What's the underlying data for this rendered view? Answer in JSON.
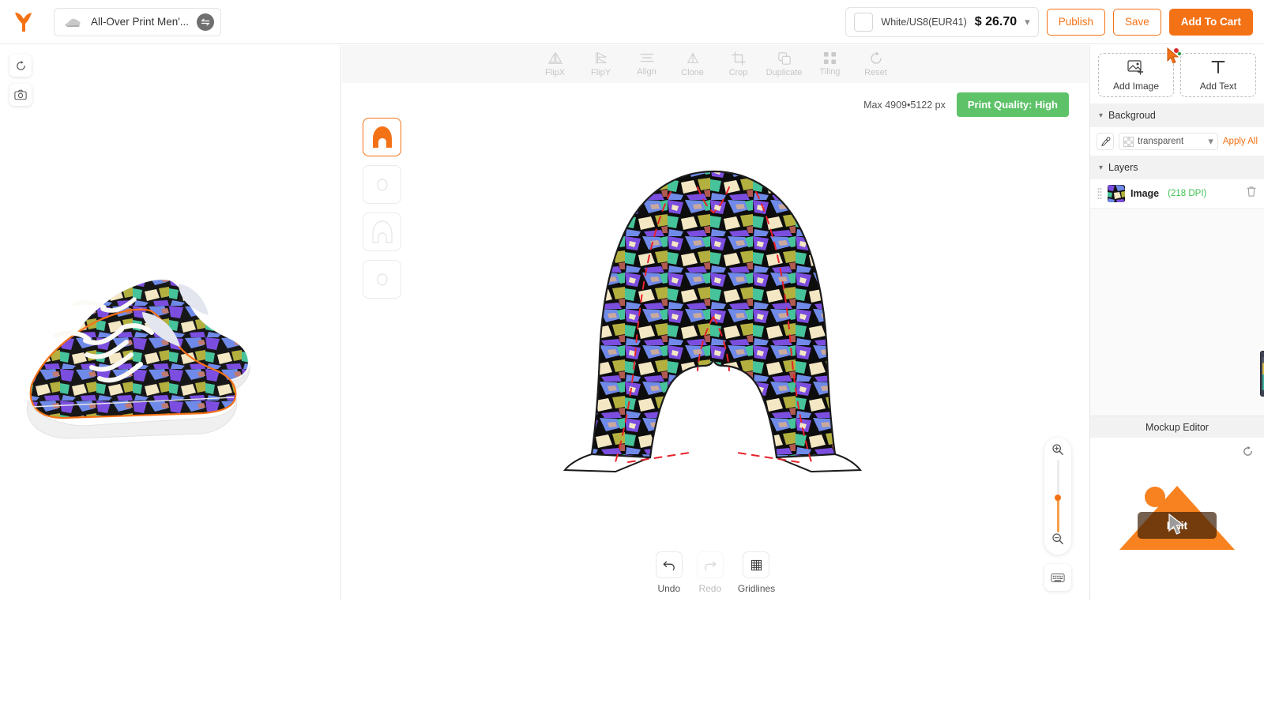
{
  "app": {
    "logo_icon": "printify-bird-logo",
    "background": "#ffffff",
    "accent": "#f47216"
  },
  "topbar": {
    "product_thumb_icon": "shoe-thumbnail-icon",
    "product_title": "All-Over Print Men'...",
    "swap_icon": "swap-product-icon",
    "variant": {
      "swatch_label": "white-color-swatch",
      "name": "White/US8(EUR41)",
      "price": "$ 26.70",
      "chevron_icon": "chevron-down-icon"
    },
    "publish_label": "Publish",
    "save_label": "Save",
    "add_to_cart_label": "Add To Cart"
  },
  "left_pane": {
    "rotate_icon": "rotate-preview-icon",
    "camera_icon": "camera-snapshot-icon",
    "preview_alt": "pair-of-sneakers-with-camo-print-preview"
  },
  "edit_toolbar": {
    "tools": [
      {
        "label": "FlipX",
        "icon": "flip-horizontal-icon",
        "enabled": false
      },
      {
        "label": "FlipY",
        "icon": "flip-vertical-icon",
        "enabled": false
      },
      {
        "label": "Align",
        "icon": "align-icon",
        "enabled": false
      },
      {
        "label": "Clone",
        "icon": "clone-icon",
        "enabled": false
      },
      {
        "label": "Crop",
        "icon": "crop-icon",
        "enabled": false
      },
      {
        "label": "Duplicate",
        "icon": "duplicate-icon",
        "enabled": false
      },
      {
        "label": "Tiling",
        "icon": "tiling-icon",
        "enabled": false
      },
      {
        "label": "Reset",
        "icon": "reset-icon",
        "enabled": false
      }
    ]
  },
  "canvas": {
    "max_px_label": "Max 4909•5122 px",
    "print_quality_label": "Print Quality: High",
    "print_quality_color": "#5ec269",
    "print_areas": [
      {
        "name": "shoe-upper-area",
        "selected": true
      },
      {
        "name": "shoe-tongue-area",
        "selected": false
      },
      {
        "name": "shoe-upper-right-area",
        "selected": false
      },
      {
        "name": "shoe-tongue-right-area",
        "selected": false
      }
    ],
    "design_alt": "shoe-upper-print-area-with-multicolor-camo-artwork"
  },
  "bottom_tools": [
    {
      "label": "Undo",
      "icon": "undo-icon",
      "enabled": true
    },
    {
      "label": "Redo",
      "icon": "redo-icon",
      "enabled": false
    },
    {
      "label": "Gridlines",
      "icon": "gridlines-icon",
      "enabled": true
    }
  ],
  "zoom_control": {
    "zoom_in_icon": "zoom-in-icon",
    "zoom_out_icon": "zoom-out-icon",
    "slider_value": 46
  },
  "keyboard_shortcuts_icon": "keyboard-shortcuts-icon",
  "right_pane": {
    "add_image_label": "Add Image",
    "add_image_icon": "add-image-icon",
    "add_text_label": "Add Text",
    "add_text_icon": "add-text-icon",
    "cursor_badge_icon": "cursor-pointer-badge",
    "background_section": {
      "title": "Backgroud",
      "caret_icon": "chevron-down-icon",
      "eyedropper_icon": "eyedropper-icon",
      "value": "transparent",
      "select_chevron_icon": "chevron-down-icon",
      "apply_all_label": "Apply All"
    },
    "layers_section": {
      "title": "Layers",
      "caret_icon": "chevron-down-icon",
      "items": [
        {
          "name": "Image",
          "dpi": "(218 DPI)",
          "dpi_color": "#3fc251",
          "grip_icon": "drag-handle-icon",
          "thumb_icon": "layer-thumbnail",
          "delete_icon": "trash-icon"
        }
      ]
    },
    "feedback_tab_icon": "feedback-tab-icon",
    "mockup_editor": {
      "title": "Mockup Editor",
      "reset_icon": "reset-rotate-icon",
      "edit_label": "Edit",
      "image_alt": "orange-mountain-placeholder-image"
    }
  }
}
